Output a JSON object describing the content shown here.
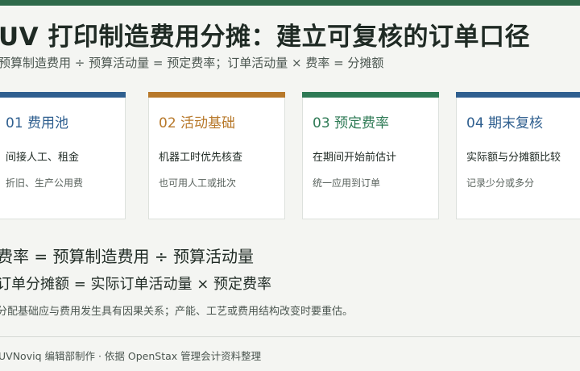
{
  "header": {
    "title": "UV 打印制造费用分摊：建立可复核的订单口径",
    "subtitle": "预算制造费用 ÷ 预算活动量 = 预定费率；订单活动量 × 费率 = 分摊额"
  },
  "cards": [
    {
      "head": "01 费用池",
      "line1": "间接人工、租金",
      "line2": "折旧、生产公用费"
    },
    {
      "head": "02 活动基础",
      "line1": "机器工时优先核查",
      "line2": "也可用人工或批次"
    },
    {
      "head": "03 预定费率",
      "line1": "在期间开始前估计",
      "line2": "统一应用到订单"
    },
    {
      "head": "04 期末复核",
      "line1": "实际额与分摊额比较",
      "line2": "记录少分或多分"
    }
  ],
  "colors": {
    "top_bar": "#2e6a4a",
    "card1": "#2f5f8f",
    "card2": "#b7782a",
    "card3": "#2e7a55",
    "card4": "#2f5f8f"
  },
  "formulas": {
    "rate": "费率 = 预算制造费用 ÷ 预算活动量",
    "allocation": "订单分摊额 = 实际订单活动量 × 预定费率"
  },
  "note": "分配基础应与费用发生具有因果关系；产能、工艺或费用结构改变时要重估。",
  "footer": "UVNoviq 编辑部制作 · 依据 OpenStax 管理会计资料整理"
}
